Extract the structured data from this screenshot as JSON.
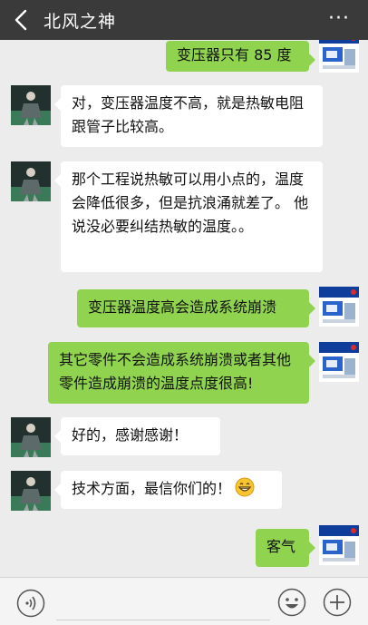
{
  "header": {
    "title": "北风之神",
    "back_icon": "chevron-left-icon",
    "more_label": "···"
  },
  "messages": [
    {
      "side": "right",
      "text": "变压器只有 85 度"
    },
    {
      "side": "left",
      "text": "对，变压器温度不高，就是热敏电阻跟管子比较高。"
    },
    {
      "side": "left",
      "text": "那个工程说热敏可以用小点的，温度会降低很多，但是抗浪涌就差了。 他说没必要纠结热敏的温度。。"
    },
    {
      "side": "right",
      "text": "变压器温度高会造成系统崩溃"
    },
    {
      "side": "right",
      "text": "其它零件不会造成系统崩溃或者其他零件造成崩溃的温度点度很高!"
    },
    {
      "side": "left",
      "text": "好的，感谢感谢！"
    },
    {
      "side": "left",
      "text": "技术方面，最信你们的！",
      "emoji": "grinning-face-icon"
    },
    {
      "side": "right",
      "text": "客气"
    }
  ],
  "colors": {
    "titlebar": "#3a3a3a",
    "background": "#ececec",
    "bubble_left": "#ffffff",
    "bubble_right": "#8fd34f"
  },
  "inputbar": {
    "voice_icon": "voice-icon",
    "emoji_icon": "smiley-icon",
    "plus_icon": "plus-icon"
  }
}
